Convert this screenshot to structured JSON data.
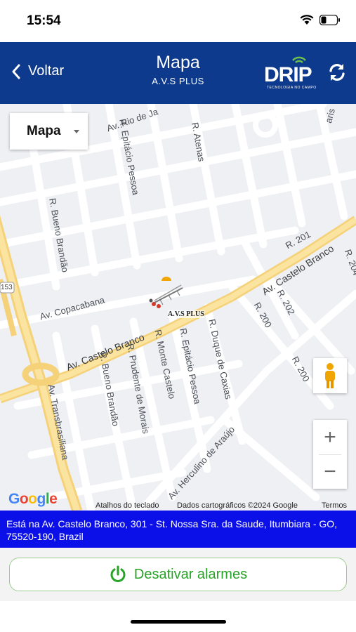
{
  "status_bar": {
    "time": "15:54"
  },
  "header": {
    "back_label": "Voltar",
    "title": "Mapa",
    "subtitle": "A.V.S PLUS",
    "logo_text": "DRIP",
    "logo_tagline": "TECNOLOGIA NO CAMPO",
    "background": "#0d3a8c"
  },
  "map": {
    "type_selector": "Mapa",
    "streets": {
      "rio_de_janeiro": "Av. Rio de Ja",
      "atenas": "R. Atenas",
      "epitacio_pessoa_top": "R. Epitácio Pessoa",
      "bueno_brandao_top": "R. Bueno Brandão",
      "r201": "R. 201",
      "castelo_branco_right": "Av. Castelo Branco",
      "r204": "R. 204",
      "r202": "R. 202",
      "r200_top": "R. 200",
      "r200_bottom": "R. 200",
      "copacabana": "Av. Copacabana",
      "castelo_branco_left": "Av. Castelo Branco",
      "bueno_brandao_bottom": "R. Bueno Brandão",
      "prudente_de_morais": "R. Prudente de Morais",
      "monte_castelo": "R. Monte Castelo",
      "epitacio_pessoa_bottom": "R. Epitácio Pessoa",
      "duque_de_caxias": "R. Duque de Caxias",
      "transbrasiliana": "Av. Transbrasiliana",
      "herculino_de_araujo": "Av. Herculino de Araújo",
      "aris": "aris",
      "br153": "153"
    },
    "marker_label": "A.V.S PLUS",
    "zoom_in": "+",
    "zoom_out": "−",
    "google": "Google",
    "attribution": {
      "shortcuts": "Atalhos do teclado",
      "data": "Dados cartográficos ©2024 Google",
      "terms": "Termos"
    }
  },
  "address": "Está na Av. Castelo Branco, 301 - St. Nossa Sra. da Saude, Itumbiara - GO, 75520-190, Brazil",
  "alarm_button": {
    "label": "Desativar alarmes",
    "color": "#27a327"
  },
  "address_bar_color": "#0b10e8"
}
